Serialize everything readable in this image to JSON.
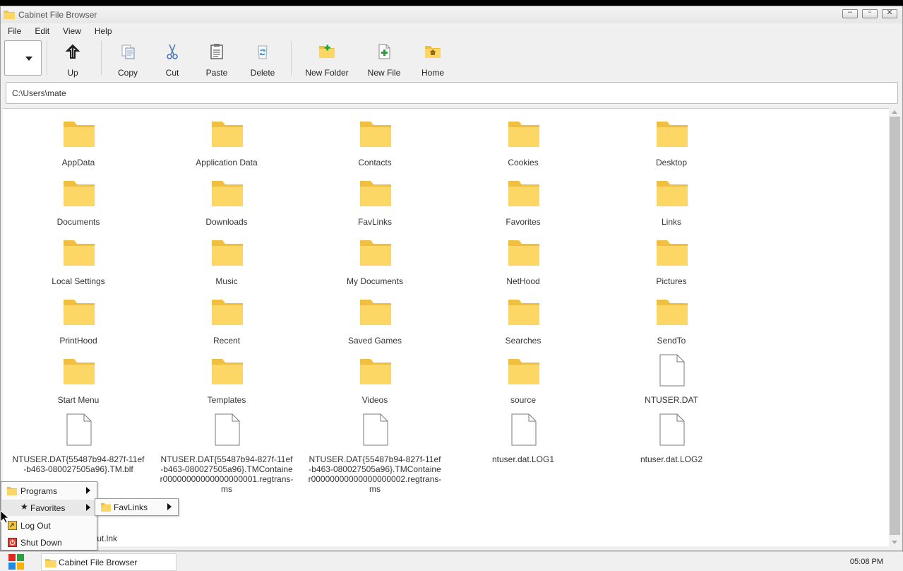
{
  "window": {
    "title": "Cabinet File Browser",
    "controls": [
      "minimize",
      "maximize",
      "close"
    ]
  },
  "menu": [
    "File",
    "Edit",
    "View",
    "Help"
  ],
  "toolbar": {
    "buttons": [
      {
        "label": "Up",
        "icon": "up-arrow-icon"
      },
      {
        "label": "Copy",
        "icon": "copy-icon"
      },
      {
        "label": "Cut",
        "icon": "scissors-icon"
      },
      {
        "label": "Paste",
        "icon": "clipboard-icon"
      },
      {
        "label": "Delete",
        "icon": "recycle-icon"
      },
      {
        "label": "New Folder",
        "icon": "new-folder-icon"
      },
      {
        "label": "New File",
        "icon": "new-file-icon"
      },
      {
        "label": "Home",
        "icon": "home-folder-icon"
      }
    ]
  },
  "address": {
    "path": "C:\\Users\\mate"
  },
  "items": [
    {
      "name": "AppData",
      "type": "folder"
    },
    {
      "name": "Application Data",
      "type": "folder"
    },
    {
      "name": "Contacts",
      "type": "folder"
    },
    {
      "name": "Cookies",
      "type": "folder"
    },
    {
      "name": "Desktop",
      "type": "folder"
    },
    {
      "name": "Documents",
      "type": "folder"
    },
    {
      "name": "Downloads",
      "type": "folder"
    },
    {
      "name": "FavLinks",
      "type": "folder"
    },
    {
      "name": "Favorites",
      "type": "folder"
    },
    {
      "name": "Links",
      "type": "folder"
    },
    {
      "name": "Local Settings",
      "type": "folder"
    },
    {
      "name": "Music",
      "type": "folder"
    },
    {
      "name": "My Documents",
      "type": "folder"
    },
    {
      "name": "NetHood",
      "type": "folder"
    },
    {
      "name": "Pictures",
      "type": "folder"
    },
    {
      "name": "PrintHood",
      "type": "folder"
    },
    {
      "name": "Recent",
      "type": "folder"
    },
    {
      "name": "Saved Games",
      "type": "folder"
    },
    {
      "name": "Searches",
      "type": "folder"
    },
    {
      "name": "SendTo",
      "type": "folder"
    },
    {
      "name": "Start Menu",
      "type": "folder"
    },
    {
      "name": "Templates",
      "type": "folder"
    },
    {
      "name": "Videos",
      "type": "folder"
    },
    {
      "name": "source",
      "type": "folder"
    },
    {
      "name": "NTUSER.DAT",
      "type": "file"
    },
    {
      "name": "NTUSER.DAT{55487b94-827f-11ef-b463-080027505a96}.TM.blf",
      "type": "file"
    },
    {
      "name": "NTUSER.DAT{55487b94-827f-11ef-b463-080027505a96}.TMContainer00000000000000000001.regtrans-ms",
      "type": "file"
    },
    {
      "name": "NTUSER.DAT{55487b94-827f-11ef-b463-080027505a96}.TMContainer00000000000000000002.regtrans-ms",
      "type": "file"
    },
    {
      "name": "ntuser.dat.LOG1",
      "type": "file"
    },
    {
      "name": "ntuser.dat.LOG2",
      "type": "file"
    },
    {
      "name": "source - Shortcut.lnk",
      "type": "folder"
    }
  ],
  "start_menu": {
    "items": [
      {
        "label": "Programs",
        "icon": "folder-icon",
        "submenu": true
      },
      {
        "label": "Favorites",
        "icon": "star-icon",
        "submenu": true
      },
      {
        "label": "Log Out",
        "icon": "logout-icon",
        "submenu": false
      },
      {
        "label": "Shut Down",
        "icon": "shutdown-icon",
        "submenu": false
      }
    ],
    "favorites_submenu": [
      {
        "label": "FavLinks",
        "icon": "folder-icon",
        "submenu": true
      }
    ]
  },
  "taskbar": {
    "task_label": "Cabinet File Browser",
    "clock": "05:08 PM"
  }
}
